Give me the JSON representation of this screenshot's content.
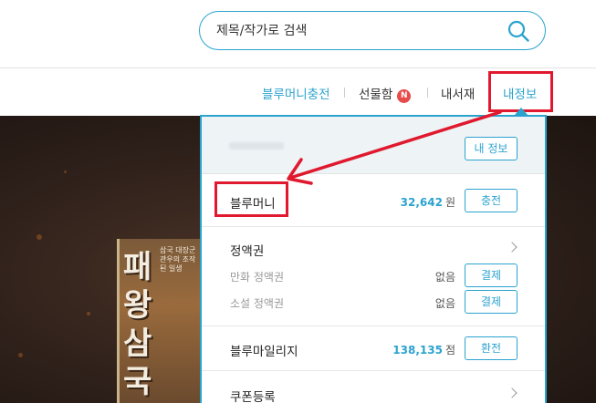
{
  "search": {
    "placeholder": "제목/작가로 검색"
  },
  "nav": {
    "items": [
      {
        "label": "블루머니충전"
      },
      {
        "label": "선물함"
      },
      {
        "label": "내서재"
      },
      {
        "label": "내정보"
      }
    ],
    "gift_badge": "N"
  },
  "cover": {
    "title": "패왕삼국",
    "subtitle": "삼국 대장군 관우의 조작된 일생"
  },
  "dropdown": {
    "my_info_button": "내 정보",
    "blue_money": {
      "label": "블루머니",
      "amount": "32,642",
      "unit": "원",
      "button": "충전"
    },
    "pass": {
      "label": "정액권",
      "items": [
        {
          "label": "만화 정액권",
          "status": "없음",
          "button": "결제"
        },
        {
          "label": "소설 정액권",
          "status": "없음",
          "button": "결제"
        }
      ]
    },
    "mileage": {
      "label": "블루마일리지",
      "amount": "138,135",
      "unit": "점",
      "button": "환전"
    },
    "coupon": {
      "label": "쿠폰등록"
    }
  },
  "colors": {
    "accent": "#2ba3cf",
    "annotation_red": "#e0192e",
    "badge": "#e84b4b"
  }
}
